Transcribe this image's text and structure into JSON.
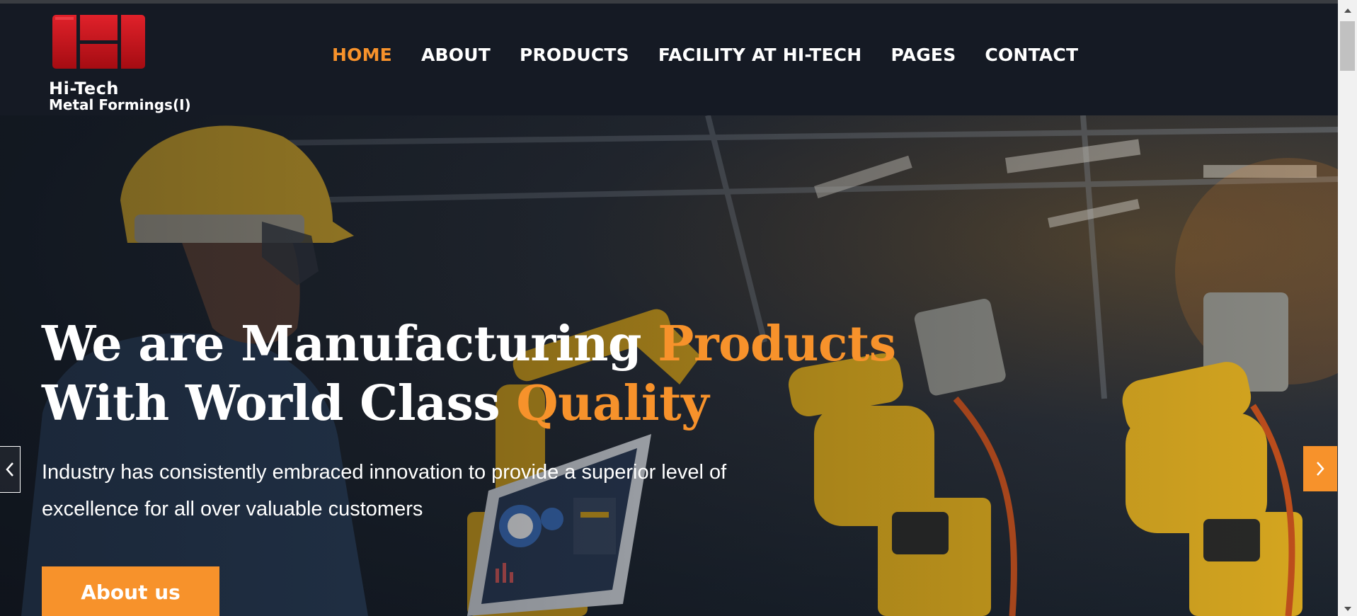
{
  "brand": {
    "name": "Hi-Tech",
    "subtitle": "Metal Formings(I)",
    "logo_color": "#d0101a"
  },
  "nav": {
    "items": [
      {
        "label": "HOME",
        "active": true
      },
      {
        "label": "ABOUT",
        "active": false
      },
      {
        "label": "PRODUCTS",
        "active": false
      },
      {
        "label": "FACILITY AT HI-TECH",
        "active": false
      },
      {
        "label": "PAGES",
        "active": false
      },
      {
        "label": "CONTACT",
        "active": false
      }
    ]
  },
  "hero": {
    "headline_line1_a": "We are Manufacturing ",
    "headline_line1_b": "Products",
    "headline_line2_a": "With World Class ",
    "headline_line2_b": "Quality",
    "text": "Industry has consistently embraced innovation to provide a superior level of excellence for all over valuable customers",
    "cta_label": "About us",
    "prev_icon": "chevron-left-icon",
    "next_icon": "chevron-right-icon"
  },
  "theme": {
    "accent": "#f7922b",
    "header_bg": "#151a24"
  }
}
